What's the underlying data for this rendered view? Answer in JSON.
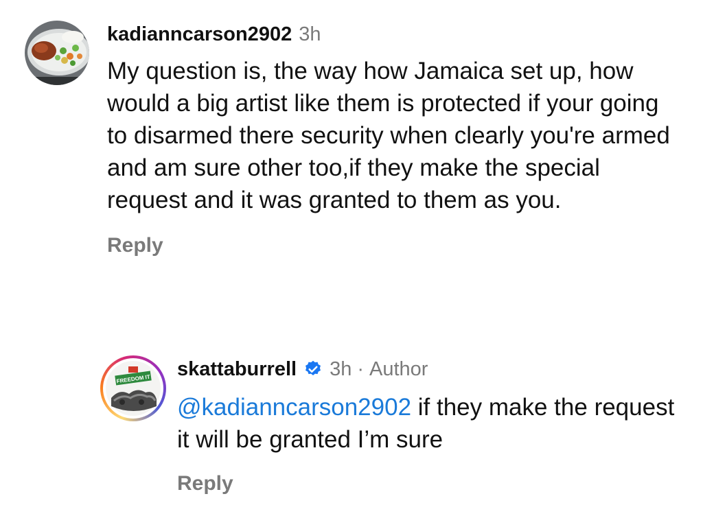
{
  "comments": [
    {
      "username": "kadianncarson2902",
      "time": "3h",
      "text": "My question is, the way how Jamaica set up, how would a big artist  like them is protected if your going to  disarmed there security when clearly you're armed and am sure other too,if they make the special request and it was granted to them as you.",
      "reply_label": "Reply"
    },
    {
      "username": "skattaburrell",
      "verified": true,
      "time": "3h",
      "separator": "·",
      "role": "Author",
      "mention": "@kadianncarson2902",
      "text": " if they make the request it will be granted I’m sure",
      "reply_label": "Reply",
      "avatar_text": "FREEDOM IT"
    }
  ],
  "colors": {
    "mention": "#1a7ad9",
    "meta": "#7a7a7a",
    "verified": "#1a77f2"
  }
}
